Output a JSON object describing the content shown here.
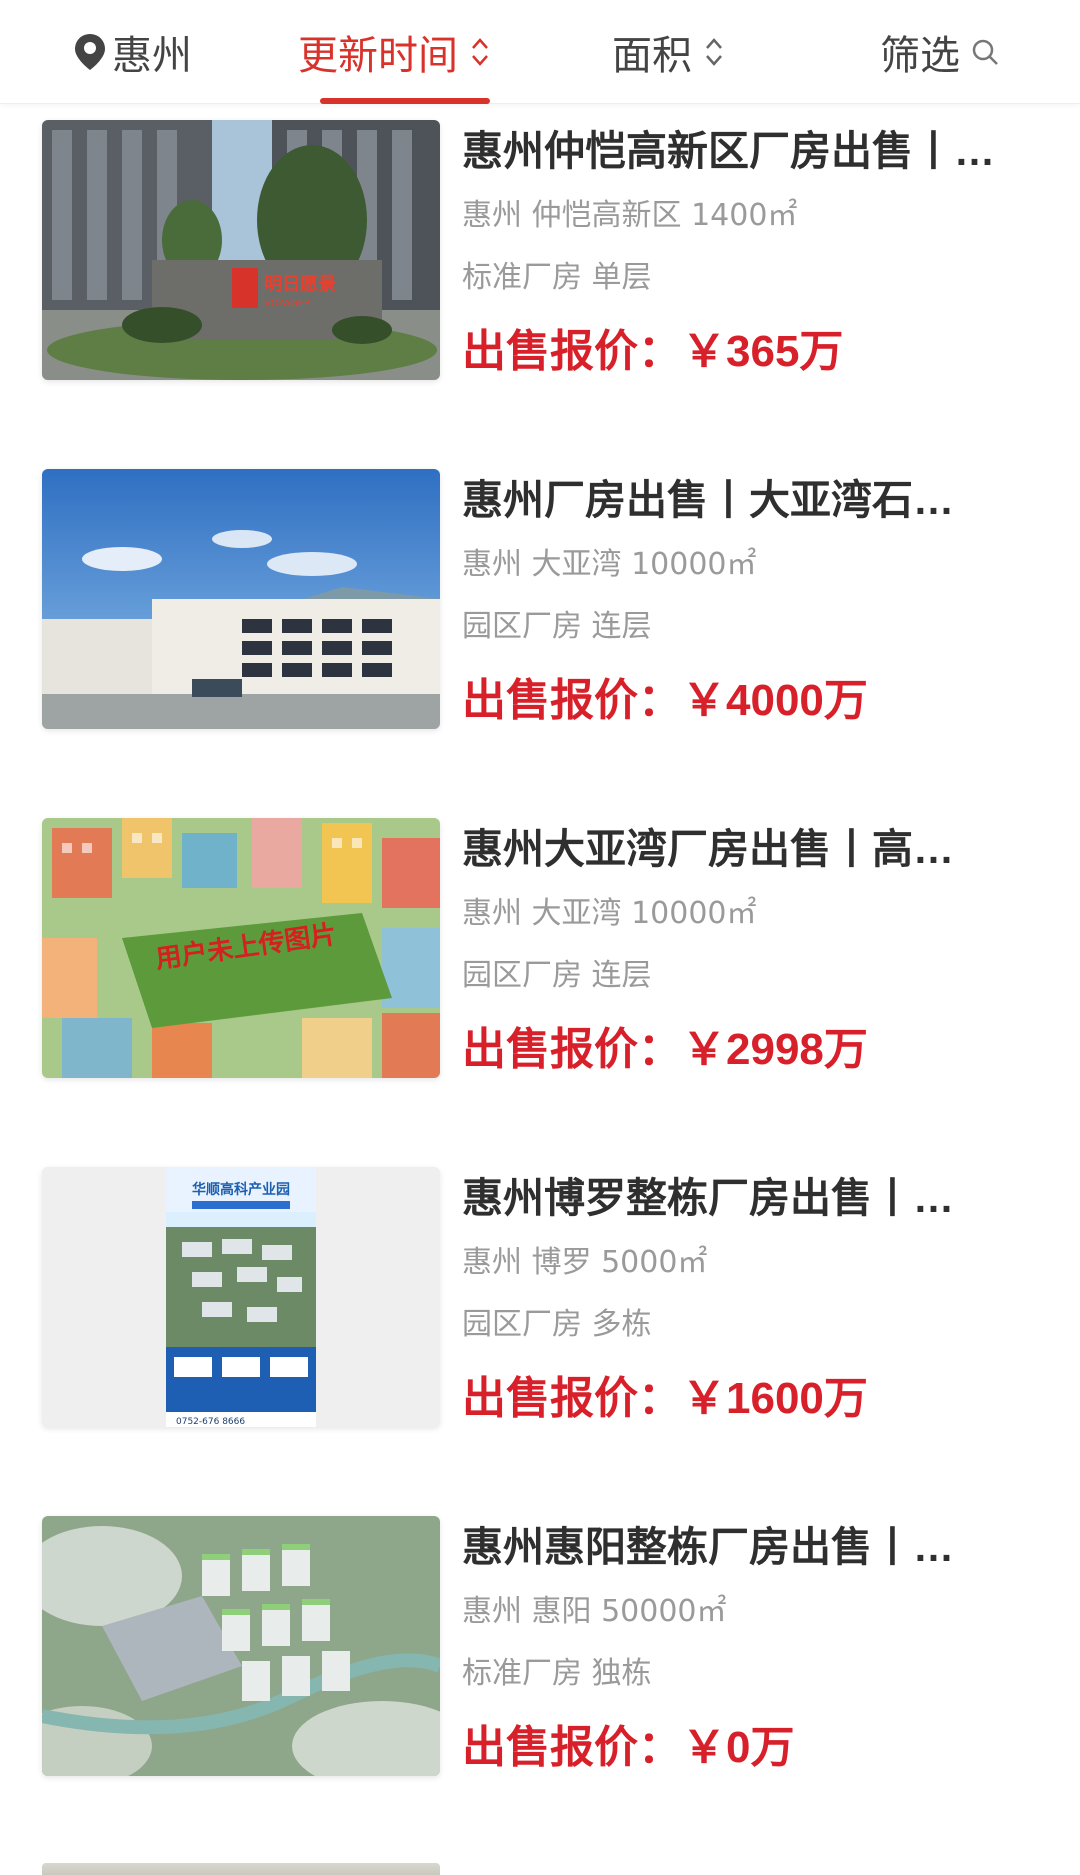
{
  "filter_bar": {
    "city": "惠州",
    "sort_time": "更新时间",
    "sort_area": "面积",
    "filter": "筛选",
    "active_color": "#d8332b",
    "icons": [
      "location-pin-icon",
      "sort-arrows-icon",
      "search-icon"
    ]
  },
  "listings": [
    {
      "title": "惠州仲恺高新区厂房出售丨…",
      "location": "惠州 仲恺高新区 1400㎡",
      "tags": "标准厂房 单层",
      "price": "出售报价：￥365万",
      "logo_text": "明日愿景",
      "logo_subtext": "VOYAGER"
    },
    {
      "title": "惠州厂房出售丨大亚湾石…",
      "location": "惠州 大亚湾 10000㎡",
      "tags": "园区厂房 连层",
      "price": "出售报价：￥4000万"
    },
    {
      "title": "惠州大亚湾厂房出售丨高…",
      "location": "惠州 大亚湾 10000㎡",
      "tags": "园区厂房 连层",
      "price": "出售报价：￥2998万",
      "placeholder_text": "用户未上传图片"
    },
    {
      "title": "惠州博罗整栋厂房出售丨…",
      "location": "惠州 博罗 5000㎡",
      "tags": "园区厂房 多栋",
      "price": "出售报价：￥1600万",
      "poster_title": "华顺高科产业园",
      "poster_phone": "0752-676 8666"
    },
    {
      "title": "惠州惠阳整栋厂房出售丨…",
      "location": "惠州 惠阳 50000㎡",
      "tags": "标准厂房 独栋",
      "price": "出售报价：￥0万"
    }
  ],
  "colors": {
    "accent": "#d8332b",
    "price": "#d8202a",
    "title": "#2f2f2f",
    "secondary": "#9a9a9a"
  }
}
